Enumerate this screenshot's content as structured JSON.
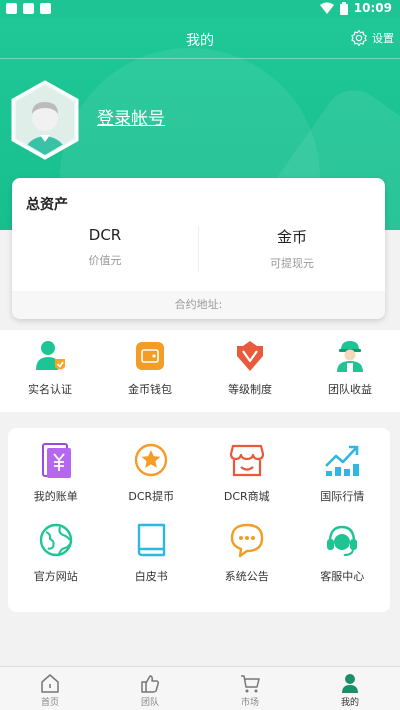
{
  "status": {
    "time": "10:09"
  },
  "header": {
    "title": "我的",
    "settings_label": "设置"
  },
  "profile": {
    "login_label": "登录帐号"
  },
  "assets": {
    "title": "总资产",
    "dcr_value": "DCR",
    "dcr_label": "价值元",
    "gold_value": "金币",
    "gold_label": "可提现元",
    "contract_label": "合约地址:"
  },
  "quick_actions": [
    {
      "label": "实名认证",
      "icon": "user-verify-icon"
    },
    {
      "label": "金币钱包",
      "icon": "wallet-icon"
    },
    {
      "label": "等级制度",
      "icon": "rank-badge-icon"
    },
    {
      "label": "团队收益",
      "icon": "worker-icon"
    }
  ],
  "services": [
    {
      "label": "我的账单",
      "icon": "bill-icon"
    },
    {
      "label": "DCR提币",
      "icon": "star-coin-icon"
    },
    {
      "label": "DCR商城",
      "icon": "shop-icon"
    },
    {
      "label": "国际行情",
      "icon": "trend-chart-icon"
    },
    {
      "label": "官方网站",
      "icon": "globe-icon"
    },
    {
      "label": "白皮书",
      "icon": "book-icon"
    },
    {
      "label": "系统公告",
      "icon": "chat-bubble-icon"
    },
    {
      "label": "客服中心",
      "icon": "headset-icon"
    }
  ],
  "tabbar": [
    {
      "label": "首页",
      "icon": "home-icon"
    },
    {
      "label": "团队",
      "icon": "team-icon"
    },
    {
      "label": "市场",
      "icon": "cart-icon"
    },
    {
      "label": "我的",
      "icon": "profile-icon"
    }
  ],
  "colors": {
    "brand": "#1fc494",
    "accent_orange": "#f39c26",
    "accent_red": "#e85a3a"
  }
}
